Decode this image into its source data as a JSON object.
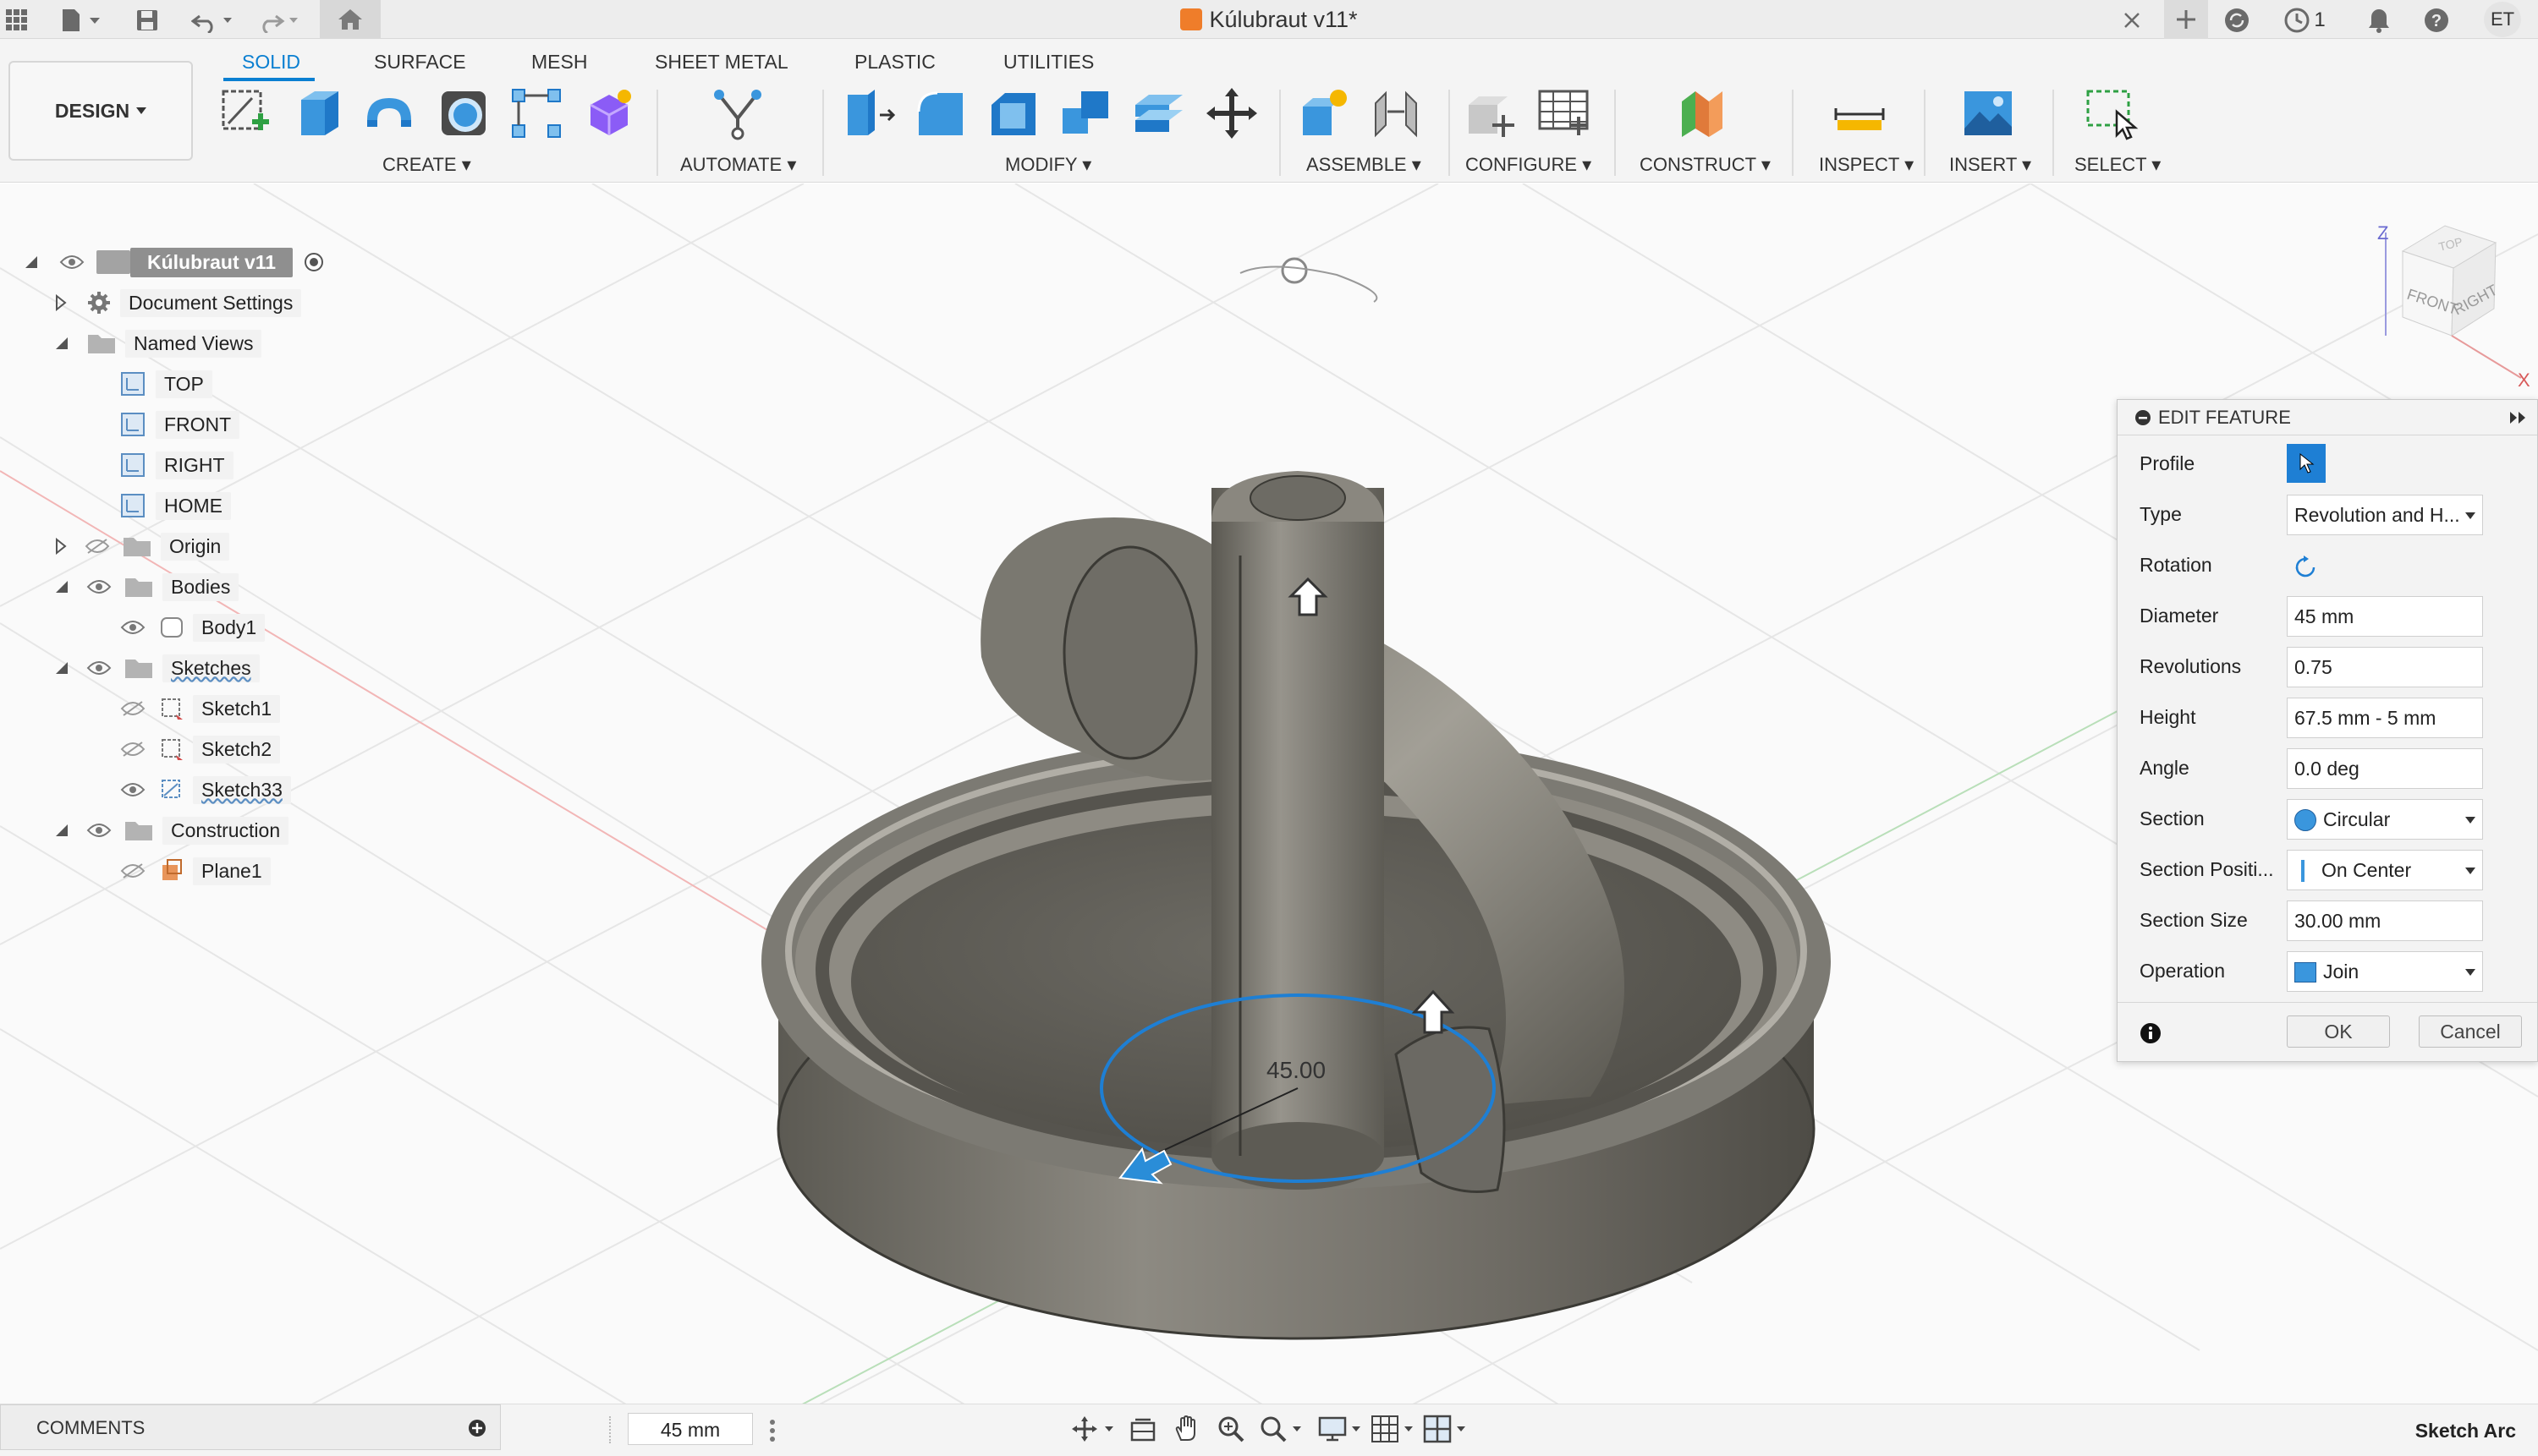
{
  "window": {
    "title": "Kúlubraut v11*"
  },
  "titlebar": {
    "jobs_count": "1",
    "user_initials": "ET"
  },
  "workspace": {
    "label": "DESIGN"
  },
  "tabs": [
    {
      "label": "SOLID",
      "active": true
    },
    {
      "label": "SURFACE"
    },
    {
      "label": "MESH"
    },
    {
      "label": "SHEET METAL"
    },
    {
      "label": "PLASTIC"
    },
    {
      "label": "UTILITIES"
    }
  ],
  "tool_groups": [
    "CREATE",
    "AUTOMATE",
    "MODIFY",
    "ASSEMBLE",
    "CONFIGURE",
    "CONSTRUCT",
    "INSPECT",
    "INSERT",
    "SELECT"
  ],
  "browser": {
    "root": "Kúlubraut v11",
    "items": [
      {
        "label": "Document Settings"
      },
      {
        "label": "Named Views"
      },
      {
        "label": "TOP"
      },
      {
        "label": "FRONT"
      },
      {
        "label": "RIGHT"
      },
      {
        "label": "HOME"
      },
      {
        "label": "Origin"
      },
      {
        "label": "Bodies"
      },
      {
        "label": "Body1"
      },
      {
        "label": "Sketches"
      },
      {
        "label": "Sketch1"
      },
      {
        "label": "Sketch2"
      },
      {
        "label": "Sketch33"
      },
      {
        "label": "Construction"
      },
      {
        "label": "Plane1"
      }
    ]
  },
  "viewport": {
    "dimension_label": "45.00"
  },
  "viewcube": {
    "top": "TOP",
    "front": "FRONT",
    "right": "RIGHT",
    "axis_z": "Z",
    "axis_x": "X"
  },
  "edit_feature": {
    "title": "EDIT FEATURE",
    "fields": [
      {
        "label": "Profile",
        "kind": "selector"
      },
      {
        "label": "Type",
        "value": "Revolution and H...",
        "kind": "select"
      },
      {
        "label": "Rotation",
        "kind": "icon"
      },
      {
        "label": "Diameter",
        "value": "45 mm",
        "kind": "input"
      },
      {
        "label": "Revolutions",
        "value": "0.75",
        "kind": "input"
      },
      {
        "label": "Height",
        "value": "67.5 mm - 5 mm",
        "kind": "input"
      },
      {
        "label": "Angle",
        "value": "0.0 deg",
        "kind": "input"
      },
      {
        "label": "Section",
        "value": "Circular",
        "kind": "select"
      },
      {
        "label": "Section Positi...",
        "value": "On Center",
        "kind": "select"
      },
      {
        "label": "Section Size",
        "value": "30.00 mm",
        "kind": "input"
      },
      {
        "label": "Operation",
        "value": "Join",
        "kind": "select"
      }
    ],
    "ok_label": "OK",
    "cancel_label": "Cancel"
  },
  "bottom": {
    "comments_label": "COMMENTS",
    "dimension_value": "45 mm",
    "status": "Sketch Arc"
  },
  "colors": {
    "accent": "#0a7fd1",
    "body_gray": "#8a877f",
    "sketch_blue": "#1e7fd4"
  }
}
